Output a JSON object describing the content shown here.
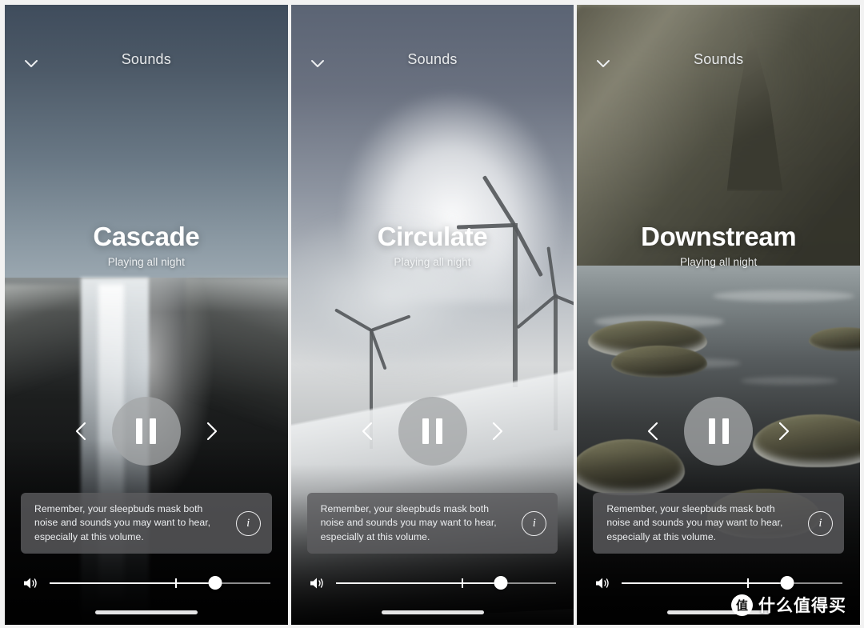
{
  "app": {
    "header_title": "Sounds",
    "collapse_icon": "chevron-down-icon"
  },
  "notice": {
    "text": "Remember, your sleepbuds mask both noise and sounds you may want to hear, especially at this volume.",
    "info_icon": "info-icon",
    "info_label": "i"
  },
  "controls": {
    "pause_label": "Pause",
    "prev_label": "Previous sound",
    "next_label": "Next sound",
    "volume_icon": "speaker-icon",
    "volume_value": 75,
    "volume_tick_position": 57
  },
  "panels": [
    {
      "header_title": "Sounds",
      "track_name": "Cascade",
      "status": "Playing all night",
      "scene": "waterfall",
      "playback_state": "playing",
      "volume_value": 75
    },
    {
      "header_title": "Sounds",
      "track_name": "Circulate",
      "status": "Playing all night",
      "scene": "wind-turbines",
      "playback_state": "playing",
      "volume_value": 75
    },
    {
      "header_title": "Sounds",
      "track_name": "Downstream",
      "status": "Playing all night",
      "scene": "mountain-river",
      "playback_state": "playing",
      "volume_value": 75
    }
  ],
  "watermark": {
    "badge": "值",
    "text": "什么值得买"
  },
  "colors": {
    "text_primary": "#ffffff",
    "text_secondary": "#e8eaec",
    "notice_bg": "#5c5d5f",
    "pause_bg": "#a4a6a8",
    "slider_fill": "#ffffff"
  }
}
